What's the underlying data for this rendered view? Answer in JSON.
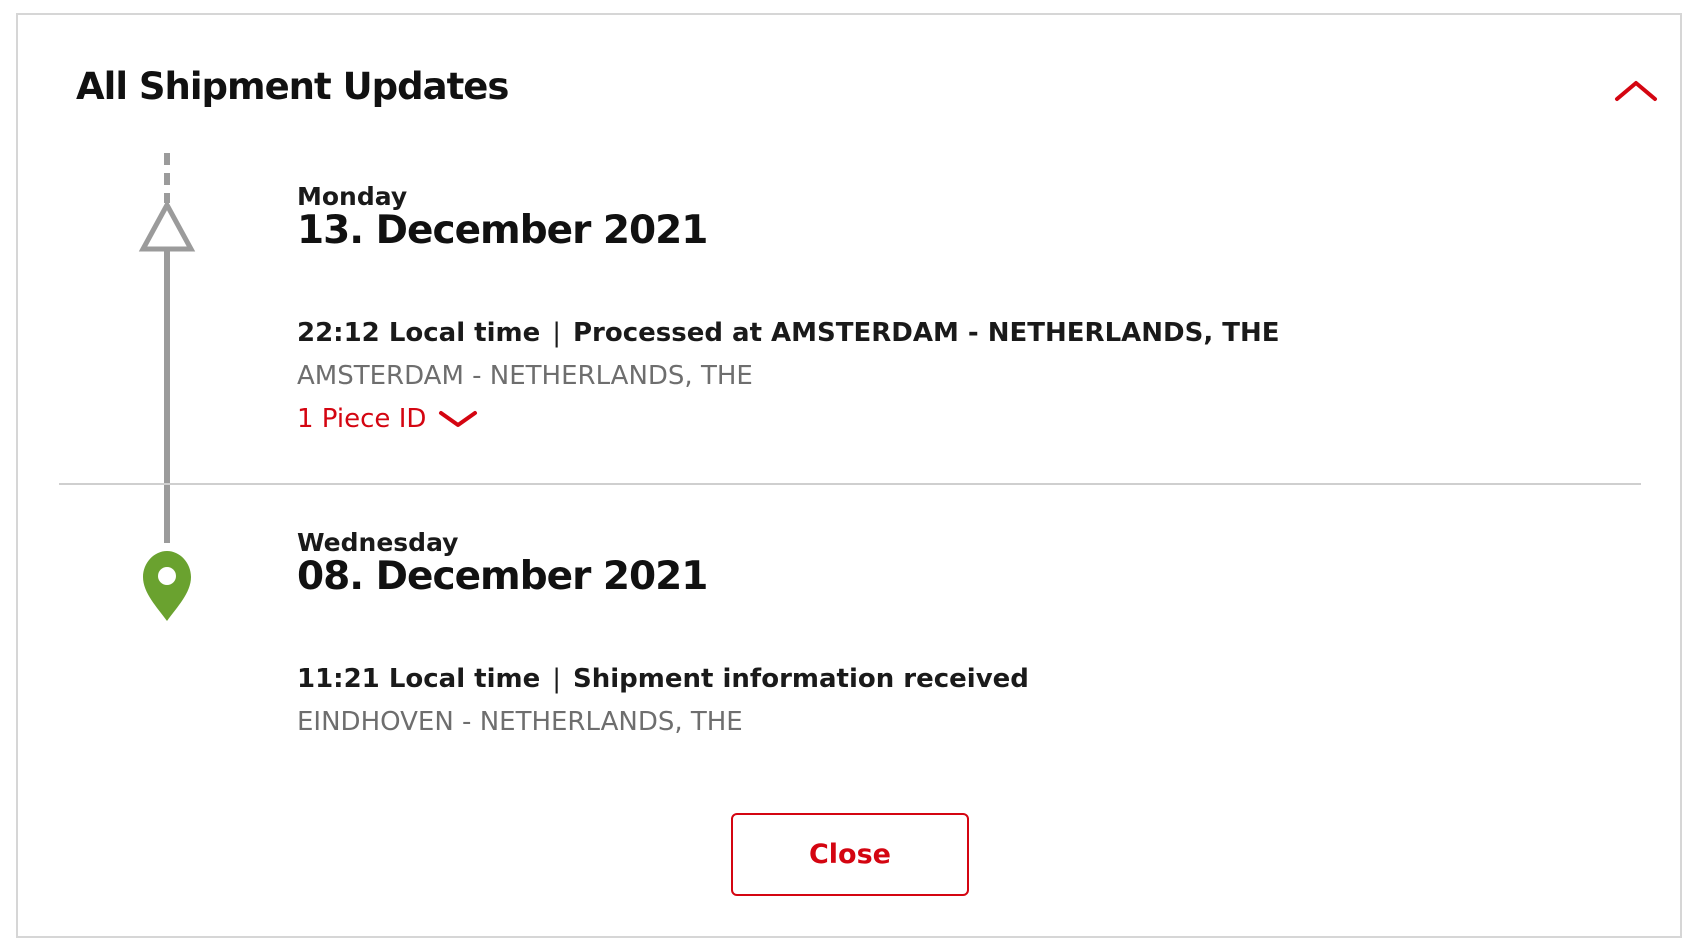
{
  "panel": {
    "title": "All Shipment Updates"
  },
  "events": [
    {
      "day": "Monday",
      "date": "13. December 2021",
      "time": "22:12 Local time",
      "separator": "|",
      "status": "Processed at AMSTERDAM - NETHERLANDS, THE",
      "location": "AMSTERDAM - NETHERLANDS, THE",
      "piece_link": "1 Piece ID"
    },
    {
      "day": "Wednesday",
      "date": "08. December 2021",
      "time": "11:21 Local time",
      "separator": "|",
      "status": "Shipment information received",
      "location": "EINDHOVEN - NETHERLANDS, THE"
    }
  ],
  "actions": {
    "close_label": "Close"
  },
  "icons": {
    "collapse": "chevron-up-icon",
    "expand_piece": "chevron-down-icon",
    "latest_event": "triangle-outline-icon",
    "origin_event": "location-pin-icon"
  },
  "colors": {
    "accent": "#d40511",
    "pin": "#6aa22f",
    "timeline": "#9b9b9b",
    "muted_text": "#6e6e6e"
  }
}
